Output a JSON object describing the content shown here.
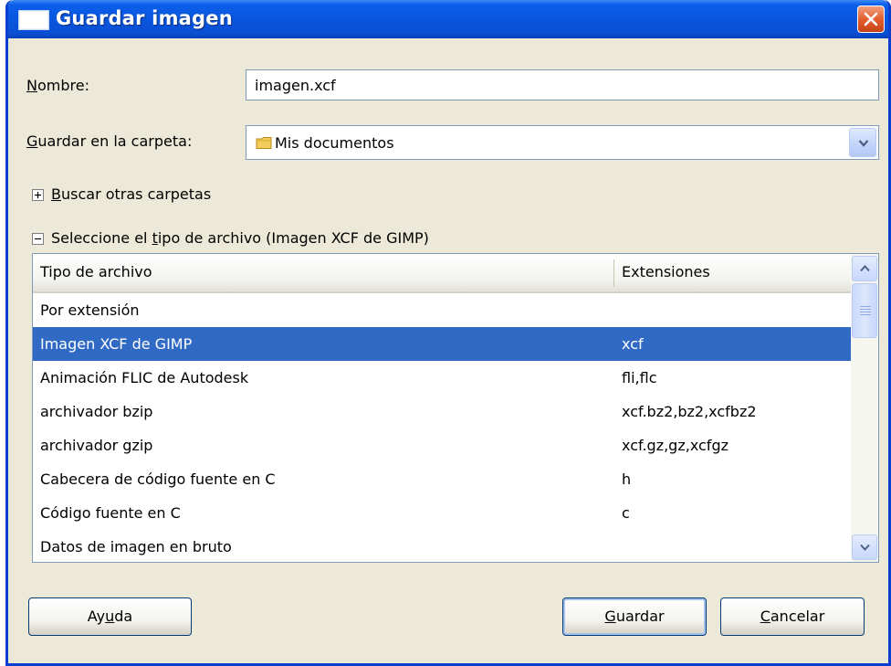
{
  "window": {
    "title": "Guardar imagen"
  },
  "form": {
    "name_label_first": "N",
    "name_label_rest": "ombre:",
    "name_value": "imagen.xcf",
    "folder_label_first": "G",
    "folder_label_rest": "uardar en la carpeta:",
    "folder_value": "Mis documentos"
  },
  "browse": {
    "label_first": "B",
    "label_rest": "uscar otras carpetas"
  },
  "filetype": {
    "label_pre": "Seleccione el ",
    "label_under": "t",
    "label_post": "ipo de archivo (Imagen XCF de GIMP)",
    "columns": [
      "Tipo de archivo",
      "Extensiones"
    ],
    "rows": [
      {
        "type": "Por extensión",
        "ext": ""
      },
      {
        "type": "Imagen XCF de GIMP",
        "ext": "xcf"
      },
      {
        "type": "Animación FLIC de Autodesk",
        "ext": "fli,flc"
      },
      {
        "type": "archivador bzip",
        "ext": "xcf.bz2,bz2,xcfbz2"
      },
      {
        "type": "archivador gzip",
        "ext": "xcf.gz,gz,xcfgz"
      },
      {
        "type": "Cabecera de código fuente en C",
        "ext": "h"
      },
      {
        "type": "Código fuente en C",
        "ext": "c"
      },
      {
        "type": "Datos de imagen en bruto",
        "ext": ""
      }
    ],
    "selected_index": 1
  },
  "buttons": {
    "help_pre": "Ay",
    "help_under": "u",
    "help_post": "da",
    "save_under": "G",
    "save_rest": "uardar",
    "cancel_under": "C",
    "cancel_rest": "ancelar"
  },
  "colors": {
    "titlebar": "#0a56df",
    "selection": "#316ac5",
    "dialog_bg": "#ece9d8"
  }
}
